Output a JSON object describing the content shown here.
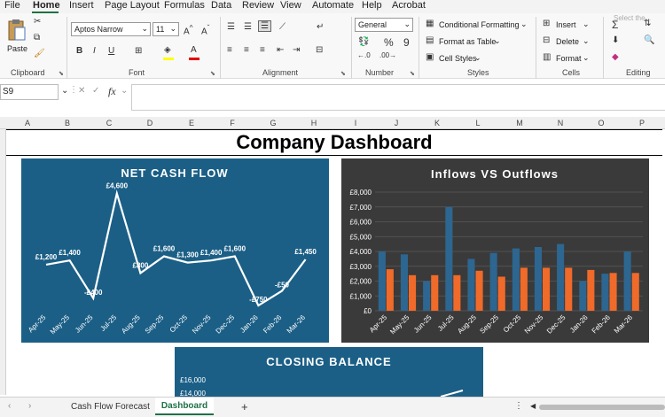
{
  "menu": {
    "items": [
      "File",
      "Home",
      "Insert",
      "Page Layout",
      "Formulas",
      "Data",
      "Review",
      "View",
      "Automate",
      "Help",
      "Acrobat"
    ],
    "active": "Home"
  },
  "ribbon": {
    "paste_label": "Paste",
    "font_name": "Aptos Narrow",
    "font_size": "11",
    "number_format": "General",
    "conditional_formatting": "Conditional Formatting",
    "format_as_table": "Format as Table",
    "cell_styles": "Cell Styles",
    "insert": "Insert",
    "delete": "Delete",
    "format": "Format",
    "select_hint": "Select the...",
    "groups": {
      "clipboard": "Clipboard",
      "font": "Font",
      "alignment": "Alignment",
      "number": "Number",
      "styles": "Styles",
      "cells": "Cells",
      "editing": "Editing"
    }
  },
  "formula_bar": {
    "name_box": "S9",
    "fx": "fx"
  },
  "columns": [
    "A",
    "B",
    "C",
    "D",
    "E",
    "F",
    "G",
    "H",
    "I",
    "J",
    "K",
    "L",
    "M",
    "N",
    "O",
    "P"
  ],
  "dashboard_title": "Company Dashboard",
  "tabs": {
    "items": [
      "Cash Flow Forecast",
      "Dashboard"
    ],
    "active": "Dashboard",
    "add": "+"
  },
  "colors": {
    "panel": "#1b5f86",
    "dark_panel": "#3a3a3a",
    "inflow": "#2d6690",
    "outflow": "#f06a2a",
    "accent": "#1e7145"
  },
  "chart_data": [
    {
      "type": "line",
      "title": "NET CASH FLOW",
      "categories": [
        "Apr-25",
        "May-25",
        "Jun-25",
        "Jul-25",
        "Aug-25",
        "Sep-25",
        "Oct-25",
        "Nov-25",
        "Dec-25",
        "Jan-26",
        "Feb-26",
        "Mar-26"
      ],
      "values": [
        1200,
        1400,
        -400,
        4600,
        800,
        1600,
        1300,
        1400,
        1600,
        -750,
        -50,
        1450
      ],
      "data_labels": [
        "£1,200",
        "£1,400",
        "-£400",
        "£4,600",
        "£800",
        "£1,600",
        "£1,300",
        "£1,400",
        "£1,600",
        "-£750",
        "-£50",
        "£1,450"
      ],
      "ylim": [
        -1000,
        5000
      ]
    },
    {
      "type": "bar",
      "title": "Inflows VS Outflows",
      "categories": [
        "Apr-25",
        "May-25",
        "Jun-25",
        "Jul-25",
        "Aug-25",
        "Sep-25",
        "Oct-25",
        "Nov-25",
        "Dec-25",
        "Jan-26",
        "Feb-26",
        "Mar-26"
      ],
      "series": [
        {
          "values": [
            4000,
            3800,
            2000,
            7000,
            3500,
            3900,
            4200,
            4300,
            4500,
            2000,
            2500,
            4000
          ]
        },
        {
          "values": [
            2800,
            2400,
            2400,
            2400,
            2700,
            2300,
            2900,
            2900,
            2900,
            2750,
            2550,
            2550
          ]
        }
      ],
      "yticks": [
        "£0",
        "£1,000",
        "£2,000",
        "£3,000",
        "£4,000",
        "£5,000",
        "£6,000",
        "£7,000",
        "£8,000"
      ],
      "ylim": [
        0,
        8000
      ],
      "grid": true
    },
    {
      "type": "line",
      "title": "CLOSING BALANCE",
      "yticks": [
        "£14,000",
        "£16,000"
      ],
      "ylim": [
        12000,
        16000
      ]
    }
  ]
}
